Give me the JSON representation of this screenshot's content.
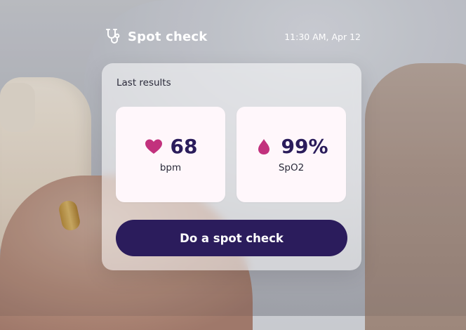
{
  "header": {
    "title": "Spot check",
    "time": "11:30 AM, Apr 12",
    "icon": "stethoscope-icon"
  },
  "card": {
    "label": "Last results",
    "metrics": [
      {
        "name": "heart-rate",
        "value": "68",
        "unit": "bpm",
        "icon": "heart-icon",
        "color": "#c2317d"
      },
      {
        "name": "spo2",
        "value": "99%",
        "unit": "SpO2",
        "icon": "drop-icon",
        "color": "#c2317d"
      }
    ],
    "button_label": "Do a spot check",
    "button_color": "#2b1c5c"
  }
}
